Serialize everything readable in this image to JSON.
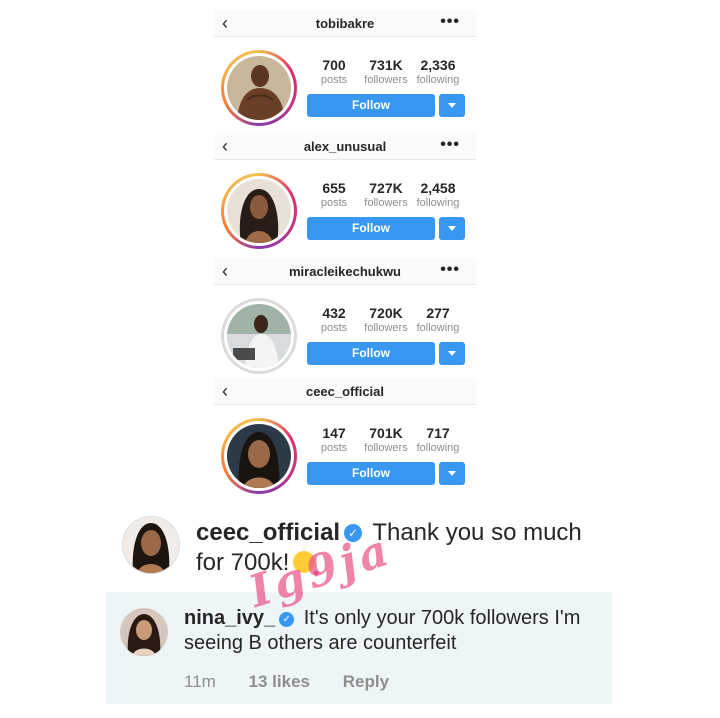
{
  "profiles": [
    {
      "username": "tobibakre",
      "posts": "700",
      "followers": "731K",
      "following": "2,336",
      "posts_label": "posts",
      "followers_label": "followers",
      "following_label": "following",
      "follow_label": "Follow",
      "back_icon": "‹",
      "more_icon": "•••"
    },
    {
      "username": "alex_unusual",
      "posts": "655",
      "followers": "727K",
      "following": "2,458",
      "posts_label": "posts",
      "followers_label": "followers",
      "following_label": "following",
      "follow_label": "Follow",
      "back_icon": "‹",
      "more_icon": "•••"
    },
    {
      "username": "miracleikechukwu",
      "posts": "432",
      "followers": "720K",
      "following": "277",
      "posts_label": "posts",
      "followers_label": "followers",
      "following_label": "following",
      "follow_label": "Follow",
      "back_icon": "‹",
      "more_icon": "•••"
    },
    {
      "username": "ceec_official",
      "posts": "147",
      "followers": "701K",
      "following": "717",
      "posts_label": "posts",
      "followers_label": "followers",
      "following_label": "following",
      "follow_label": "Follow",
      "back_icon": "‹",
      "more_icon": "•••"
    }
  ],
  "comment": {
    "username": "ceec_official",
    "text": "Thank you so much for 700k!",
    "emoji": "kissing-heart-emoji",
    "verified_icon": "✓"
  },
  "reply": {
    "username": "nina_ivy_",
    "text": "It's only your 700k followers I'm seeing B others are counterfeit",
    "time": "11m",
    "likes": "13 likes",
    "reply_label": "Reply",
    "verified_icon": "✓"
  },
  "watermark": "Ig9ja",
  "colors": {
    "follow_blue": "#3897f0",
    "ring_gradient": "#e1306c",
    "reply_bg": "#eef5f7",
    "watermark": "#eb5a8c"
  }
}
